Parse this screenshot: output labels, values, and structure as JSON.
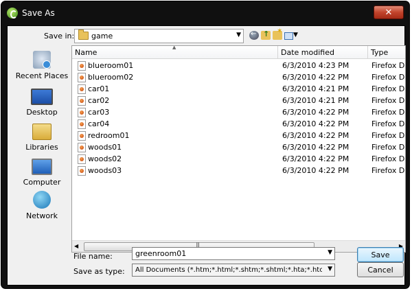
{
  "window": {
    "title": "Save As",
    "close_label": "✕"
  },
  "toolbar": {
    "save_in_label": "Save in:",
    "location": "game"
  },
  "places": [
    {
      "label": "Recent Places",
      "icon": "recent-places-icon"
    },
    {
      "label": "Desktop",
      "icon": "desktop-icon"
    },
    {
      "label": "Libraries",
      "icon": "libraries-icon"
    },
    {
      "label": "Computer",
      "icon": "computer-icon"
    },
    {
      "label": "Network",
      "icon": "network-icon"
    }
  ],
  "columns": {
    "name": "Name",
    "date": "Date modified",
    "type": "Type"
  },
  "files": [
    {
      "name": "blueroom01",
      "date": "6/3/2010 4:23 PM",
      "type": "Firefox Do"
    },
    {
      "name": "blueroom02",
      "date": "6/3/2010 4:22 PM",
      "type": "Firefox Do"
    },
    {
      "name": "car01",
      "date": "6/3/2010 4:21 PM",
      "type": "Firefox Do"
    },
    {
      "name": "car02",
      "date": "6/3/2010 4:21 PM",
      "type": "Firefox Do"
    },
    {
      "name": "car03",
      "date": "6/3/2010 4:22 PM",
      "type": "Firefox Do"
    },
    {
      "name": "car04",
      "date": "6/3/2010 4:22 PM",
      "type": "Firefox Do"
    },
    {
      "name": "redroom01",
      "date": "6/3/2010 4:22 PM",
      "type": "Firefox Do"
    },
    {
      "name": "woods01",
      "date": "6/3/2010 4:22 PM",
      "type": "Firefox Do"
    },
    {
      "name": "woods02",
      "date": "6/3/2010 4:22 PM",
      "type": "Firefox Do"
    },
    {
      "name": "woods03",
      "date": "6/3/2010 4:22 PM",
      "type": "Firefox Do"
    }
  ],
  "form": {
    "file_name_label": "File name:",
    "file_name_value": "greenroom01",
    "save_as_type_label": "Save as type:",
    "save_as_type_value": "All Documents (*.htm;*.html;*.shtm;*.shtml;*.hta;*.htc;*.xhtml;*.stm;*.ss"
  },
  "buttons": {
    "save": "Save",
    "cancel": "Cancel"
  }
}
